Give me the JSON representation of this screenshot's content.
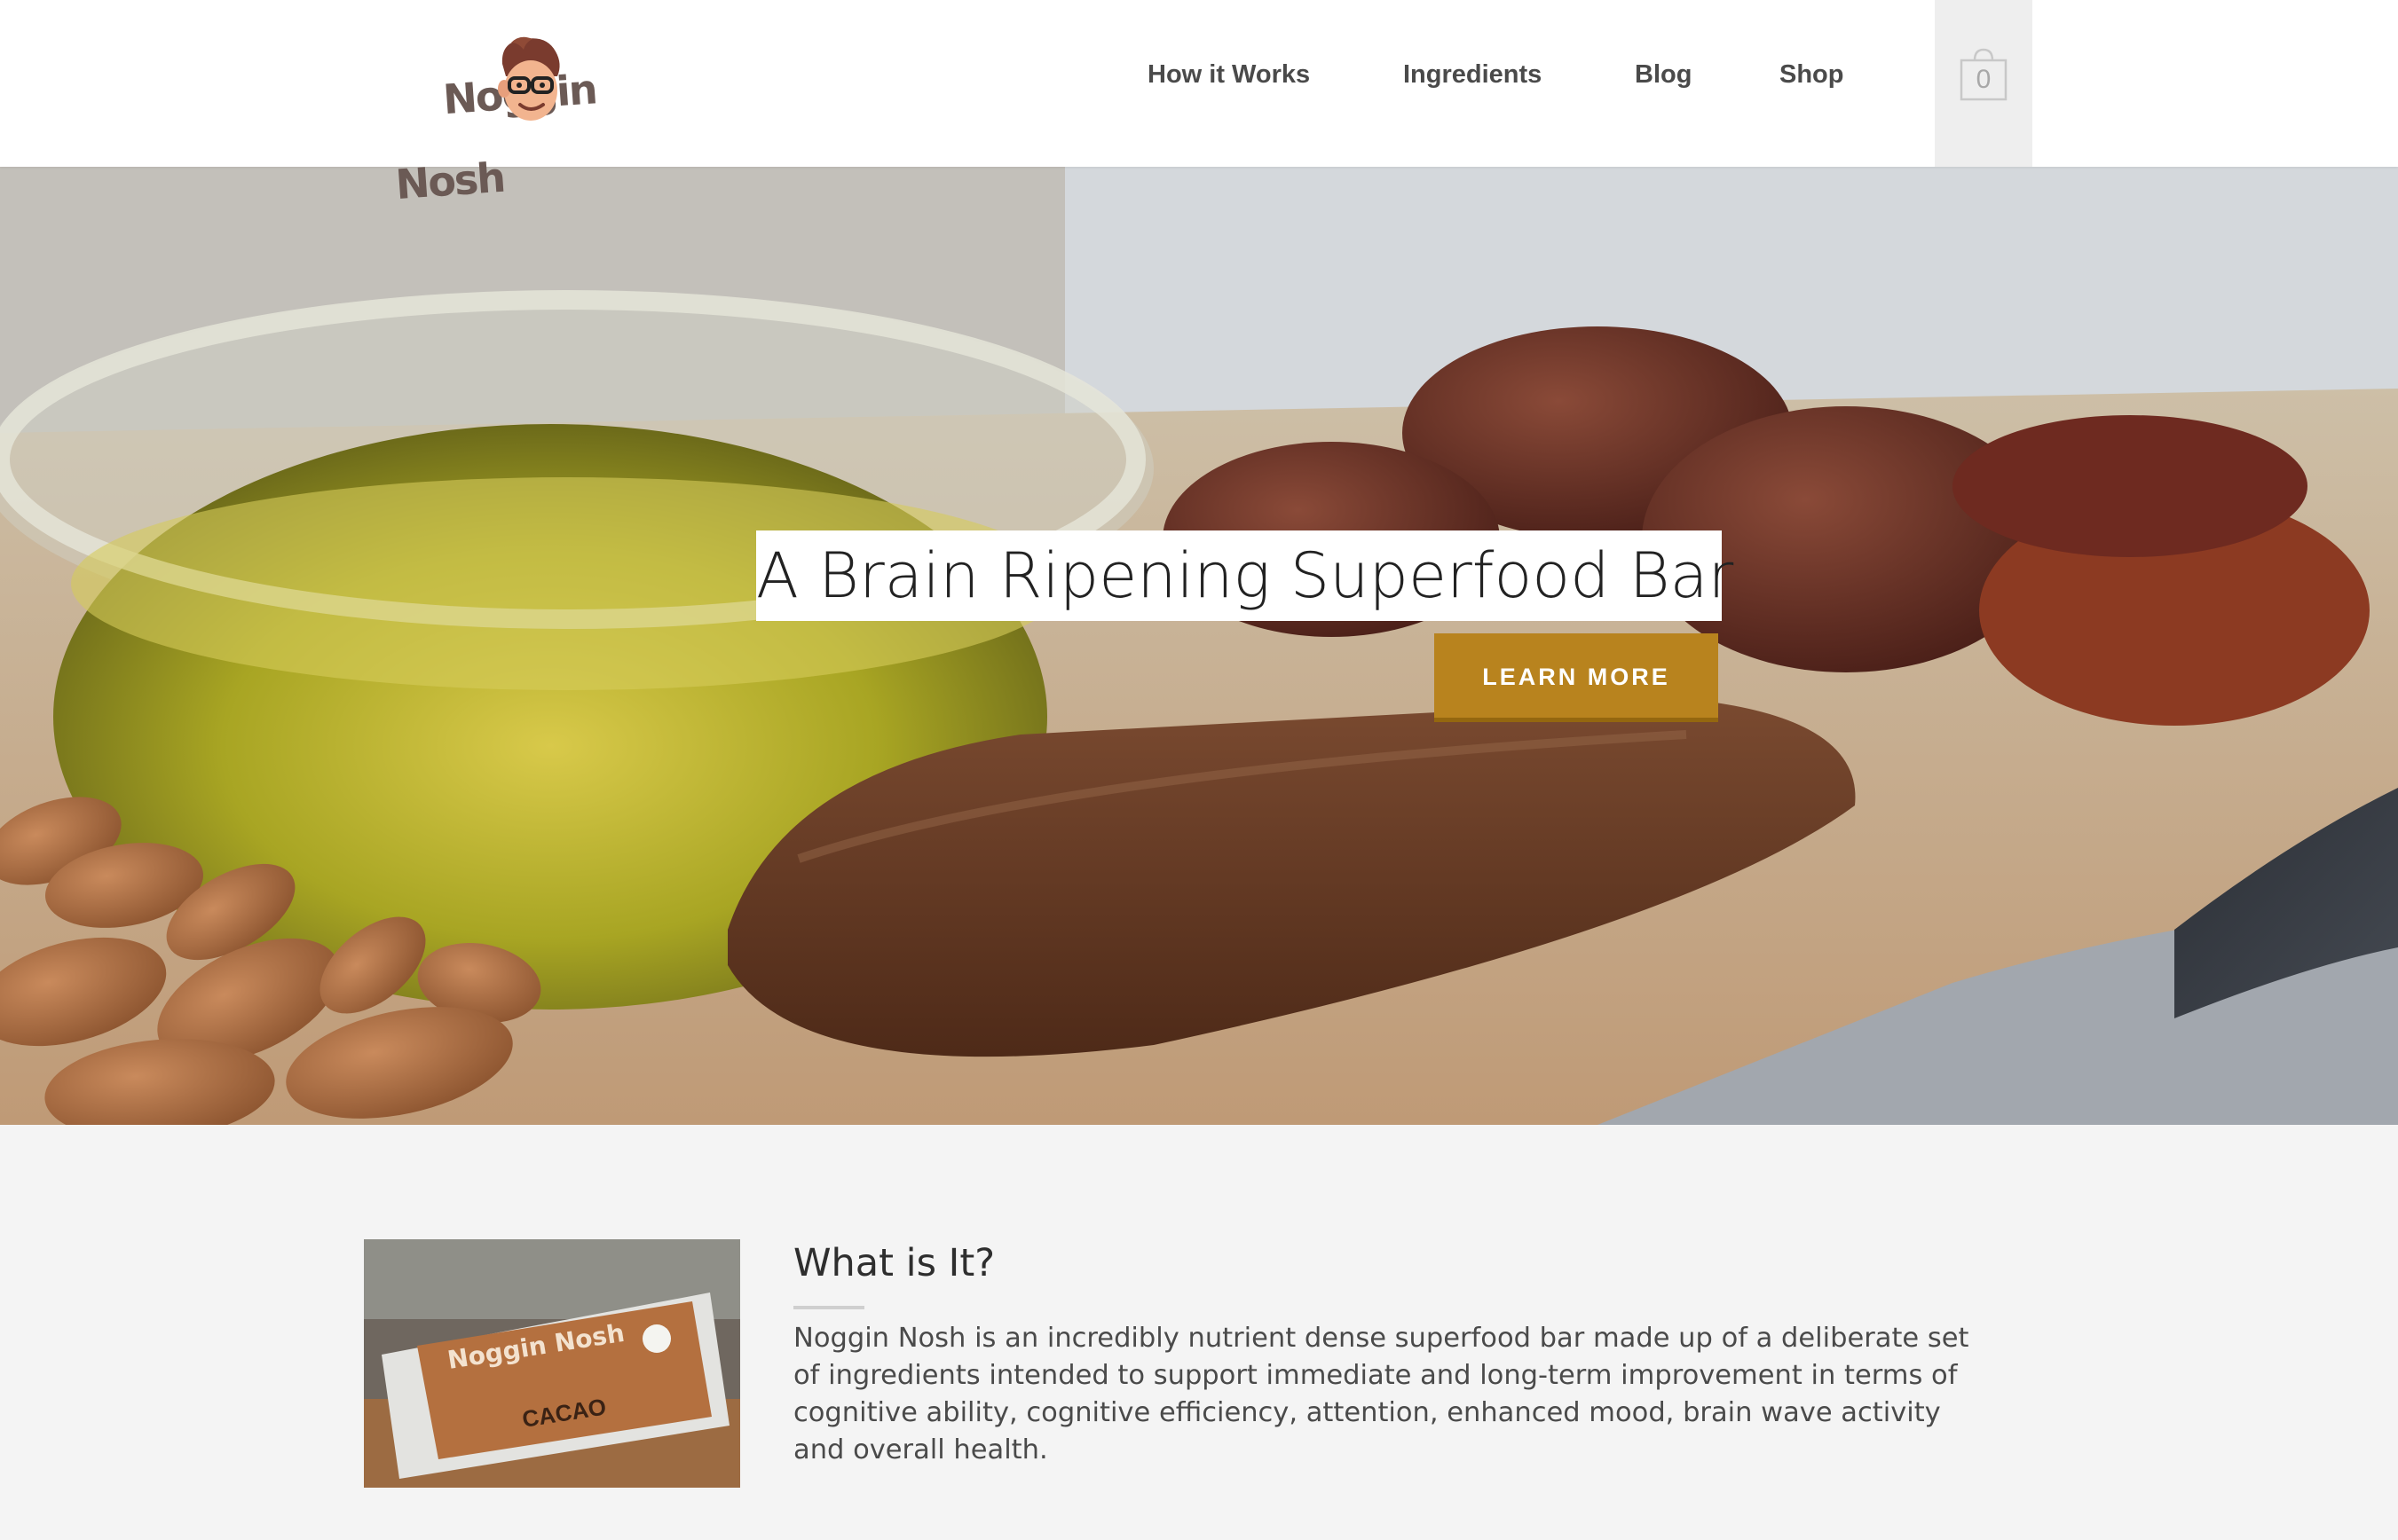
{
  "brand": {
    "name_line1": "Noggin",
    "name_line2": "Nosh"
  },
  "nav": {
    "items": [
      {
        "label": "How it Works"
      },
      {
        "label": "Ingredients"
      },
      {
        "label": "Blog"
      },
      {
        "label": "Shop"
      }
    ]
  },
  "cart": {
    "count": "0",
    "icon": "shopping-bag-icon"
  },
  "hero": {
    "title": "A Brain Ripening Superfood Bar",
    "cta_label": "LEARN MORE",
    "cta_color": "#b8831e"
  },
  "about": {
    "heading": "What is It?",
    "body": "Noggin Nosh is an incredibly nutrient dense superfood bar made up of a deliberate set of ingredients intended to support immediate and long-term improvement in terms of cognitive ability, cognitive efficiency, attention, enhanced mood, brain wave activity and overall health.",
    "product_label_brand": "Noggin Nosh",
    "product_label_flavor": "CACAO"
  },
  "colors": {
    "header_bg": "#ffffff",
    "section_bg": "#f4f4f4",
    "accent": "#b8831e",
    "nav_text": "#4a4a4a"
  }
}
